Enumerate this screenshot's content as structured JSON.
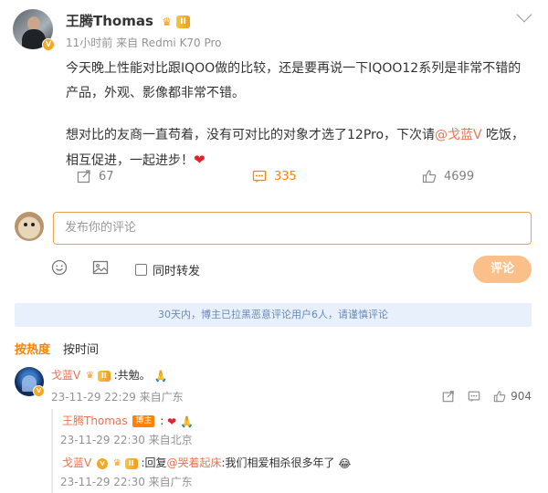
{
  "post": {
    "author": "王腾Thomas",
    "level_badge": "II",
    "meta": "11小时前 来自 Redmi K70 Pro",
    "paragraph1": "今天晚上性能对比跟IQOO做的比较，还是要再说一下IQOO12系列是非常不错的产品，外观、影像都非常不错。",
    "paragraph2_before": "想对比的友商一直苟着，没有可对比的对象才选了12Pro，下次请",
    "mention": "@戈蓝V",
    "paragraph2_after": " 吃饭，相互促进，一起进步！",
    "heart": "❤"
  },
  "actions": {
    "repost_count": "67",
    "comment_count": "335",
    "like_count": "4699"
  },
  "compose": {
    "placeholder": "发布你的评论",
    "repost_checkbox_label": "同时转发",
    "submit_label": "评论"
  },
  "notice": "30天内，博主已拉黑恶意评论用户6人，请谨慎评论",
  "sort_tabs": [
    "按热度",
    "按时间"
  ],
  "comment": {
    "user": "戈蓝V",
    "level_badge": "II",
    "text": ":共勉。",
    "emoji": "🙏",
    "meta": "23-11-29 22:29 来自广东",
    "like_count": "904"
  },
  "replies": [
    {
      "user": "王腾Thomas",
      "tag": "博主",
      "text": ":",
      "emoji1": "❤",
      "emoji2": "🙏",
      "meta": "23-11-29 22:30 来自北京"
    },
    {
      "user": "戈蓝V",
      "level_badge": "II",
      "text_prefix": ":回复",
      "mention": "@哭着起床",
      "text_suffix": ":我们相爱相杀很多年了",
      "emoji": "😂",
      "meta": "23-11-29 22:30 来自广东"
    }
  ],
  "colors": {
    "accent": "#ff8200",
    "link": "#eb7350",
    "notice_bg": "#e8f1fb",
    "notice_text": "#6989b8"
  }
}
